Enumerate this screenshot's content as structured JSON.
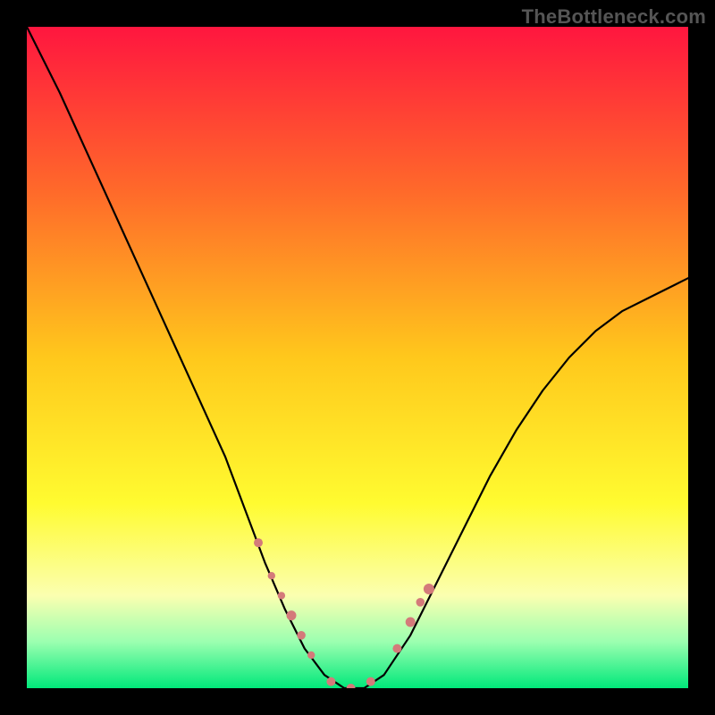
{
  "watermark": "TheBottleneck.com",
  "chart_data": {
    "type": "line",
    "title": "",
    "xlabel": "",
    "ylabel": "",
    "xlim": [
      0,
      100
    ],
    "ylim": [
      0,
      100
    ],
    "grid": false,
    "legend": false,
    "gradient_stops": [
      {
        "offset": 0,
        "color": "#ff163f"
      },
      {
        "offset": 25,
        "color": "#ff6a2a"
      },
      {
        "offset": 50,
        "color": "#ffc81c"
      },
      {
        "offset": 72,
        "color": "#fffb30"
      },
      {
        "offset": 86,
        "color": "#fbffb0"
      },
      {
        "offset": 93,
        "color": "#9bffb0"
      },
      {
        "offset": 100,
        "color": "#00e87a"
      }
    ],
    "series": [
      {
        "name": "bottleneck-curve",
        "x": [
          0,
          5,
          10,
          15,
          20,
          25,
          30,
          33,
          36,
          39,
          42,
          45,
          48,
          51,
          54,
          58,
          62,
          66,
          70,
          74,
          78,
          82,
          86,
          90,
          94,
          98,
          100
        ],
        "values": [
          100,
          90,
          79,
          68,
          57,
          46,
          35,
          27,
          19,
          12,
          6,
          2,
          0,
          0,
          2,
          8,
          16,
          24,
          32,
          39,
          45,
          50,
          54,
          57,
          59,
          61,
          62
        ]
      }
    ],
    "markers": {
      "name": "highlight-points",
      "color": "#d47a7a",
      "x": [
        35,
        37,
        38.5,
        40,
        41.5,
        43,
        46,
        49,
        52,
        56,
        58,
        59.5,
        60.8
      ],
      "values": [
        22,
        17,
        14,
        11,
        8,
        5,
        1,
        0,
        1,
        6,
        10,
        13,
        15
      ],
      "radius": [
        5,
        4.2,
        4.2,
        5.5,
        4.8,
        4.2,
        5,
        5,
        5,
        5,
        5.5,
        4.8,
        6
      ]
    }
  }
}
